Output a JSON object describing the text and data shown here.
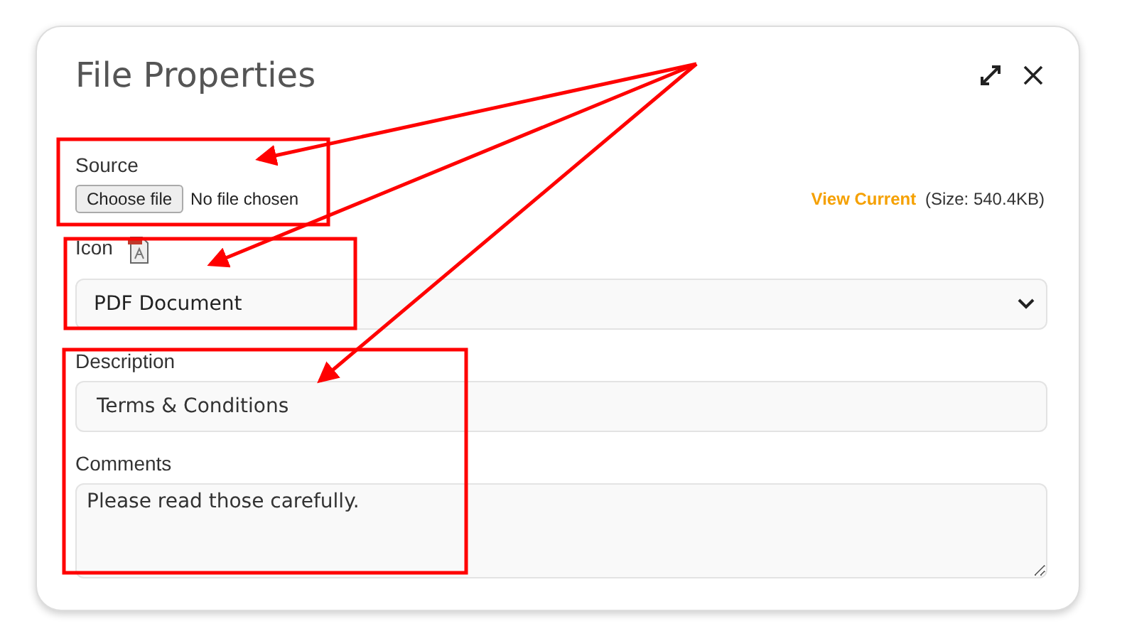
{
  "dialog": {
    "title": "File Properties"
  },
  "source": {
    "label": "Source",
    "button": "Choose file",
    "status": "No file chosen",
    "link": "View Current",
    "size": "(Size: 540.4KB)"
  },
  "icon": {
    "label": "Icon",
    "value": "PDF Document"
  },
  "description": {
    "label": "Description",
    "value": "Terms & Conditions"
  },
  "comments": {
    "label": "Comments",
    "value": "Please read those carefully."
  }
}
